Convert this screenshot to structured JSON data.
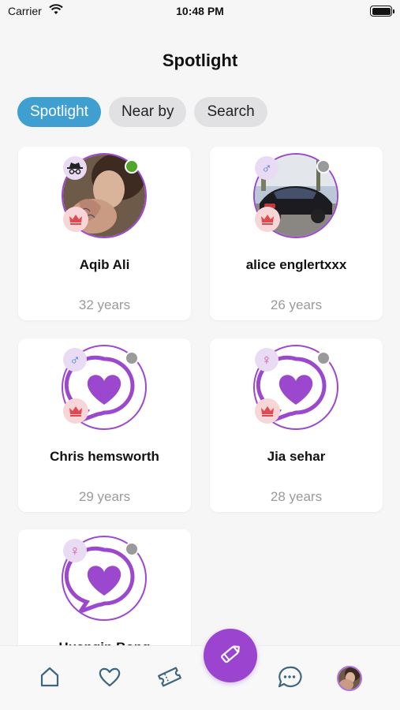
{
  "status_bar": {
    "carrier": "Carrier",
    "time": "10:48 PM"
  },
  "header": {
    "title": "Spotlight"
  },
  "tabs": [
    {
      "label": "Spotlight",
      "active": true
    },
    {
      "label": "Near by",
      "active": false
    },
    {
      "label": "Search",
      "active": false
    }
  ],
  "profiles": [
    {
      "name": "Aqib Ali",
      "age": "32 years",
      "type_icon": "incognito-icon",
      "online": true,
      "photo": "photo"
    },
    {
      "name": "alice englertxxx",
      "age": "26 years",
      "type_icon": "male-icon",
      "online": false,
      "photo": "photo"
    },
    {
      "name": "Chris hemsworth",
      "age": "29 years",
      "type_icon": "male-icon",
      "online": false,
      "photo": "default-heart-logo"
    },
    {
      "name": "Jia sehar",
      "age": "28 years",
      "type_icon": "female-icon",
      "online": false,
      "photo": "default-heart-logo"
    },
    {
      "name": "Huangin Bong",
      "age": "",
      "type_icon": "female-icon",
      "online": false,
      "photo": "default-heart-logo"
    }
  ],
  "bottom_nav": [
    {
      "icon": "home-icon"
    },
    {
      "icon": "heart-icon"
    },
    {
      "icon": "ticket-icon"
    },
    {
      "icon": "edit-icon"
    },
    {
      "icon": "chat-icon"
    },
    {
      "icon": "profile-avatar"
    }
  ],
  "colors": {
    "accent": "#9a44cf",
    "tab_active": "#3f9fd1",
    "crown": "#e0494f",
    "online": "#4ea62a",
    "offline": "#9a9a9a"
  }
}
